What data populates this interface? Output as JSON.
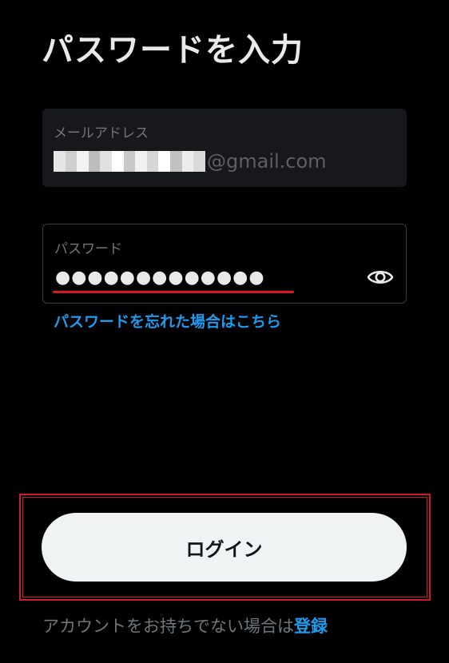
{
  "header": {
    "title": "パスワードを入力"
  },
  "email_field": {
    "label": "メールアドレス",
    "value_domain": "@gmail.com",
    "redacted_pixel_colors": [
      "#e6e6e6",
      "#cfcfcf",
      "#f2f2f2",
      "#bdbdbd",
      "#e0e0e0",
      "#ffffff",
      "#c8c8c8",
      "#f0f0f0",
      "#d6d6d6",
      "#ffffff",
      "#c2c2c2",
      "#ececec",
      "#d9d9d9"
    ]
  },
  "password_field": {
    "label": "パスワード",
    "value_masked": "●●●●●●●●●●●●●",
    "reveal_icon": "eye-icon"
  },
  "forgot_password_link": "パスワードを忘れた場合はこちら",
  "login_button": {
    "label": "ログイン"
  },
  "signup": {
    "prompt": "アカウントをお持ちでない場合は",
    "link": "登録"
  },
  "colors": {
    "background": "#000000",
    "accent_link": "#1d9bf0",
    "annotation_red": "#cc1b2d",
    "button_bg": "#eff3f4"
  }
}
